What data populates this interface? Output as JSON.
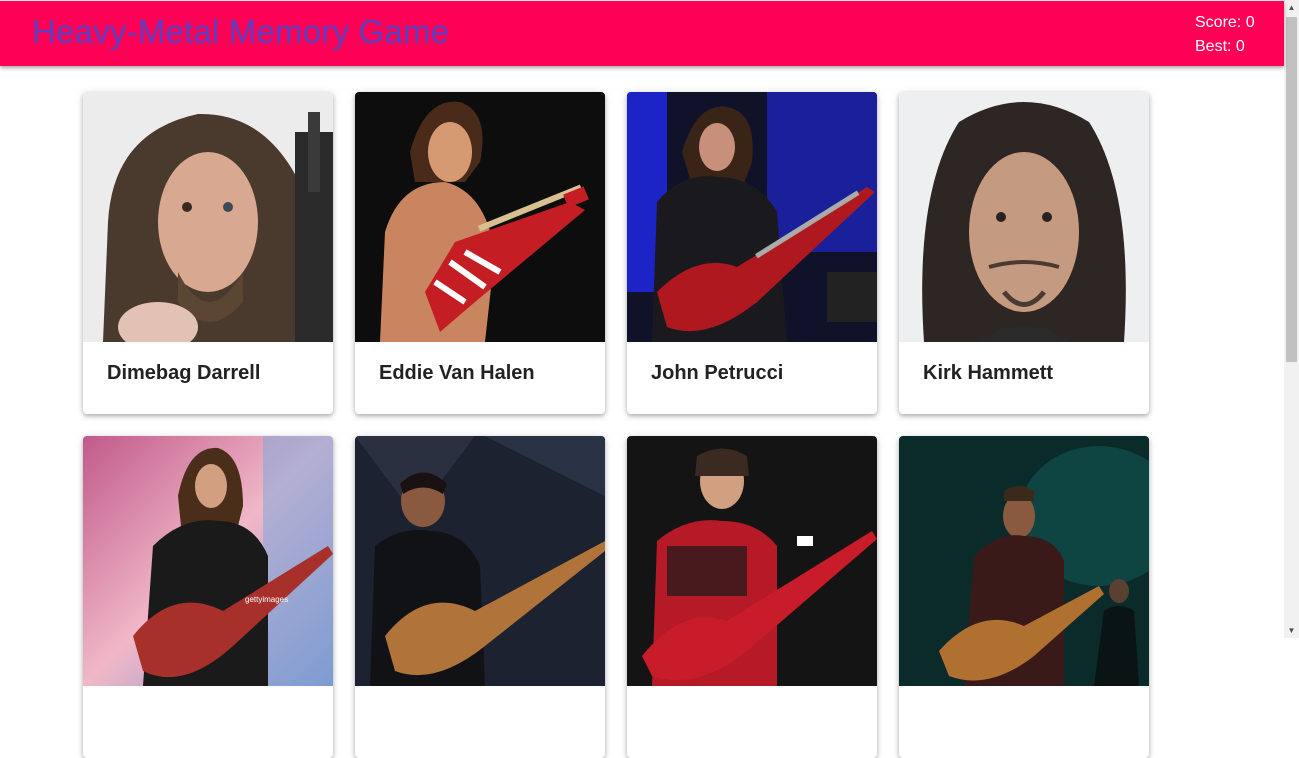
{
  "header": {
    "title": "Heavy-Metal Memory Game",
    "score_label": "Score:",
    "score_value": "0",
    "best_label": "Best:",
    "best_value": "0",
    "background_color": "#ff0057",
    "title_color": "#5a3fc0"
  },
  "cards": [
    {
      "name": "Dimebag Darrell"
    },
    {
      "name": "Eddie Van Halen"
    },
    {
      "name": "John Petrucci"
    },
    {
      "name": "Kirk Hammett"
    },
    {
      "name": ""
    },
    {
      "name": ""
    },
    {
      "name": ""
    },
    {
      "name": ""
    }
  ],
  "watermark": "gettyimages"
}
